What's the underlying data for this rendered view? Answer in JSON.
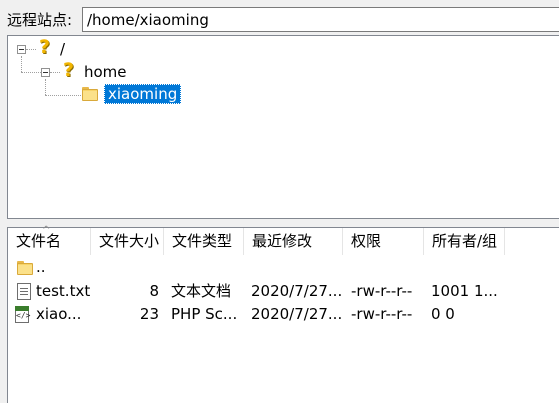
{
  "path_bar": {
    "label": "远程站点:",
    "value": "/home/xiaoming"
  },
  "tree": {
    "nodes": [
      {
        "label": "/",
        "icon": "question-icon",
        "expanded": true
      },
      {
        "label": "home",
        "icon": "question-icon",
        "expanded": true
      },
      {
        "label": "xiaoming",
        "icon": "folder-icon",
        "selected": true
      }
    ],
    "selection_color": "#0078d7"
  },
  "file_list": {
    "columns": [
      "文件名",
      "文件大小",
      "文件类型",
      "最近修改",
      "权限",
      "所有者/组"
    ],
    "sort_indicator": "^",
    "rows": [
      {
        "icon": "folder-icon",
        "name": "..",
        "size": "",
        "type": "",
        "modified": "",
        "permissions": "",
        "owner": ""
      },
      {
        "icon": "text-file-icon",
        "name": "test.txt",
        "size": "8",
        "type": "文本文档",
        "modified": "2020/7/27...",
        "permissions": "-rw-r--r--",
        "owner": "1001 1..."
      },
      {
        "icon": "php-file-icon",
        "name": "xiao...",
        "size": "23",
        "type": "PHP Sc...",
        "modified": "2020/7/27...",
        "permissions": "-rw-r--r--",
        "owner": "0 0"
      }
    ]
  }
}
